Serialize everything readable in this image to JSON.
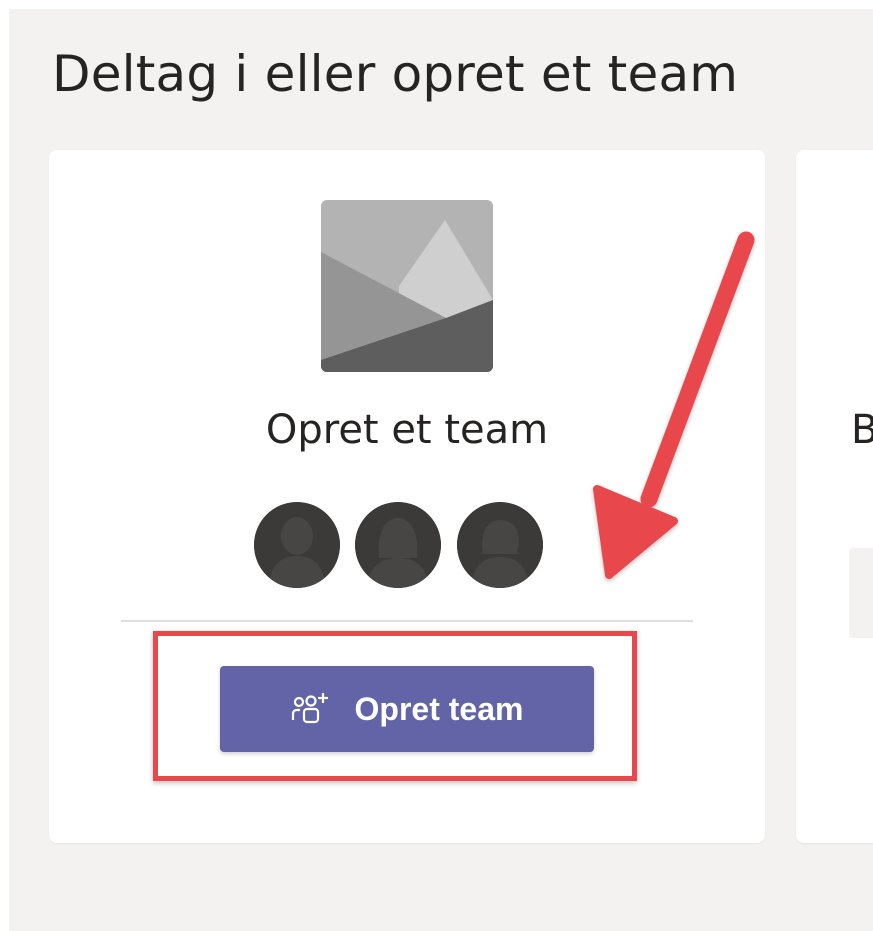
{
  "page": {
    "title": "Deltag i eller opret et team"
  },
  "create_card": {
    "image_icon": "landscape-placeholder-icon",
    "title": "Opret et team",
    "avatars": [
      "person-icon",
      "person-icon",
      "person-icon"
    ],
    "button_icon": "add-team-icon",
    "button_label": "Opret team"
  },
  "join_card": {
    "title_partial": "B"
  },
  "annotation": {
    "arrow_color": "#e8474c",
    "highlight_color": "#e8474c"
  },
  "colors": {
    "background": "#f3f2f1",
    "card": "#ffffff",
    "accent": "#6264a7",
    "text": "#252423",
    "avatar": "#3b3a39"
  }
}
